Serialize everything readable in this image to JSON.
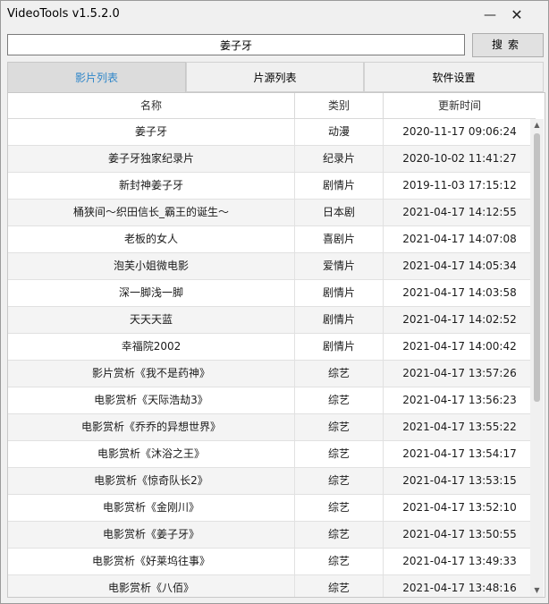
{
  "window": {
    "title": "VideoTools v1.5.2.0",
    "minimize_glyph": "—",
    "close_glyph": "✕"
  },
  "search": {
    "value": "姜子牙",
    "button_label": "搜索"
  },
  "tabs": [
    {
      "label": "影片列表",
      "active": true
    },
    {
      "label": "片源列表",
      "active": false
    },
    {
      "label": "软件设置",
      "active": false
    }
  ],
  "table": {
    "columns": [
      "名称",
      "类别",
      "更新时间"
    ],
    "rows": [
      [
        "姜子牙",
        "动漫",
        "2020-11-17 09:06:24"
      ],
      [
        "姜子牙独家纪录片",
        "纪录片",
        "2020-10-02 11:41:27"
      ],
      [
        "新封神姜子牙",
        "剧情片",
        "2019-11-03 17:15:12"
      ],
      [
        "桶狭间～织田信长_霸王的诞生～",
        "日本剧",
        "2021-04-17 14:12:55"
      ],
      [
        "老板的女人",
        "喜剧片",
        "2021-04-17 14:07:08"
      ],
      [
        "泡芙小姐微电影",
        "爱情片",
        "2021-04-17 14:05:34"
      ],
      [
        "深一脚浅一脚",
        "剧情片",
        "2021-04-17 14:03:58"
      ],
      [
        "天天天蓝",
        "剧情片",
        "2021-04-17 14:02:52"
      ],
      [
        "幸福院2002",
        "剧情片",
        "2021-04-17 14:00:42"
      ],
      [
        "影片赏析《我不是药神》",
        "综艺",
        "2021-04-17 13:57:26"
      ],
      [
        "电影赏析《天际浩劫3》",
        "综艺",
        "2021-04-17 13:56:23"
      ],
      [
        "电影赏析《乔乔的异想世界》",
        "综艺",
        "2021-04-17 13:55:22"
      ],
      [
        "电影赏析《沐浴之王》",
        "综艺",
        "2021-04-17 13:54:17"
      ],
      [
        "电影赏析《惊奇队长2》",
        "综艺",
        "2021-04-17 13:53:15"
      ],
      [
        "电影赏析《金刚川》",
        "综艺",
        "2021-04-17 13:52:10"
      ],
      [
        "电影赏析《姜子牙》",
        "综艺",
        "2021-04-17 13:50:55"
      ],
      [
        "电影赏析《好莱坞往事》",
        "综艺",
        "2021-04-17 13:49:33"
      ],
      [
        "电影赏析《八佰》",
        "综艺",
        "2021-04-17 13:48:16"
      ]
    ]
  },
  "scrollbar": {
    "up_glyph": "▲",
    "down_glyph": "▼"
  },
  "colors": {
    "active_tab_text": "#2f86c9",
    "background": "#f0f0f0"
  }
}
